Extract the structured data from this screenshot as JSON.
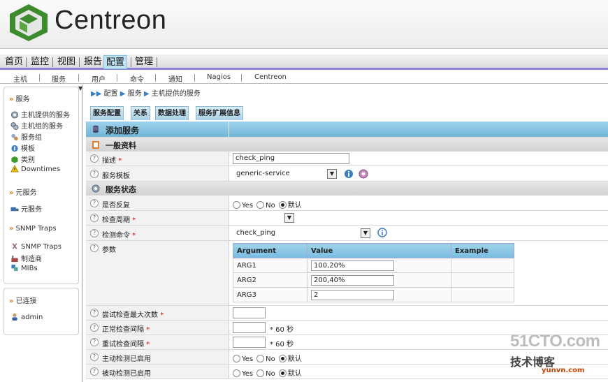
{
  "app": {
    "logo_text": "Centreon"
  },
  "main_nav": [
    "首页",
    "监控",
    "视图",
    "报告",
    "配置",
    "管理"
  ],
  "main_nav_active": "配置",
  "sub_nav": [
    "主机",
    "服务",
    "用户",
    "命令",
    "通知",
    "Nagios",
    "Centreon"
  ],
  "sidebar": {
    "services": {
      "header": "服务",
      "items": [
        "主机提供的服务",
        "主机组的服务",
        "服务组",
        "模板",
        "类别",
        "Downtimes"
      ]
    },
    "meta": {
      "header": "元服务",
      "items": [
        "元服务"
      ]
    },
    "snmp": {
      "header": "SNMP Traps",
      "items": [
        "SNMP Traps",
        "制造商",
        "MIBs"
      ]
    },
    "connected": {
      "header": "已连接",
      "user": "admin"
    }
  },
  "breadcrumb": [
    "配置",
    "服务",
    "主机提供的服务"
  ],
  "tabs": [
    "服务配置",
    "关系",
    "数据处理",
    "服务扩展信息"
  ],
  "form": {
    "title": "添加服务",
    "section_general": "一般资料",
    "description_label": "描述",
    "description_value": "check_ping",
    "template_label": "服务模板",
    "template_value": "generic-service",
    "section_state": "服务状态",
    "volatile_label": "是否反复",
    "period_label": "检查周期",
    "period_value": "",
    "command_label": "检测命令",
    "command_value": "check_ping",
    "args_label": "参数",
    "args_table": {
      "headers": [
        "Argument",
        "Value",
        "Example"
      ],
      "rows": [
        {
          "arg": "ARG1",
          "value": "100,20%",
          "example": ""
        },
        {
          "arg": "ARG2",
          "value": "200,40%",
          "example": ""
        },
        {
          "arg": "ARG3",
          "value": "2",
          "example": ""
        }
      ]
    },
    "max_attempts_label": "尝试检查最大次数",
    "max_attempts_value": "",
    "normal_interval_label": "正常检查间隔",
    "normal_interval_value": "",
    "normal_interval_unit": "* 60 秒",
    "retry_interval_label": "重试检查间隔",
    "retry_interval_value": "",
    "retry_interval_unit": "* 60 秒",
    "active_checks_label": "主动检测已启用",
    "passive_checks_label": "被动检测已启用",
    "radio_yes": "Yes",
    "radio_no": "No",
    "radio_default": "默认",
    "required_mark": "*"
  },
  "watermark": {
    "line1": "51CTO.com",
    "line2": "技术博客",
    "line3": "yunvn.com"
  },
  "colors": {
    "accent": "#8b7fd8",
    "tab": "#a9cfe6",
    "title_bar": "#6fb6da",
    "link_arrow": "#3a80c8"
  }
}
